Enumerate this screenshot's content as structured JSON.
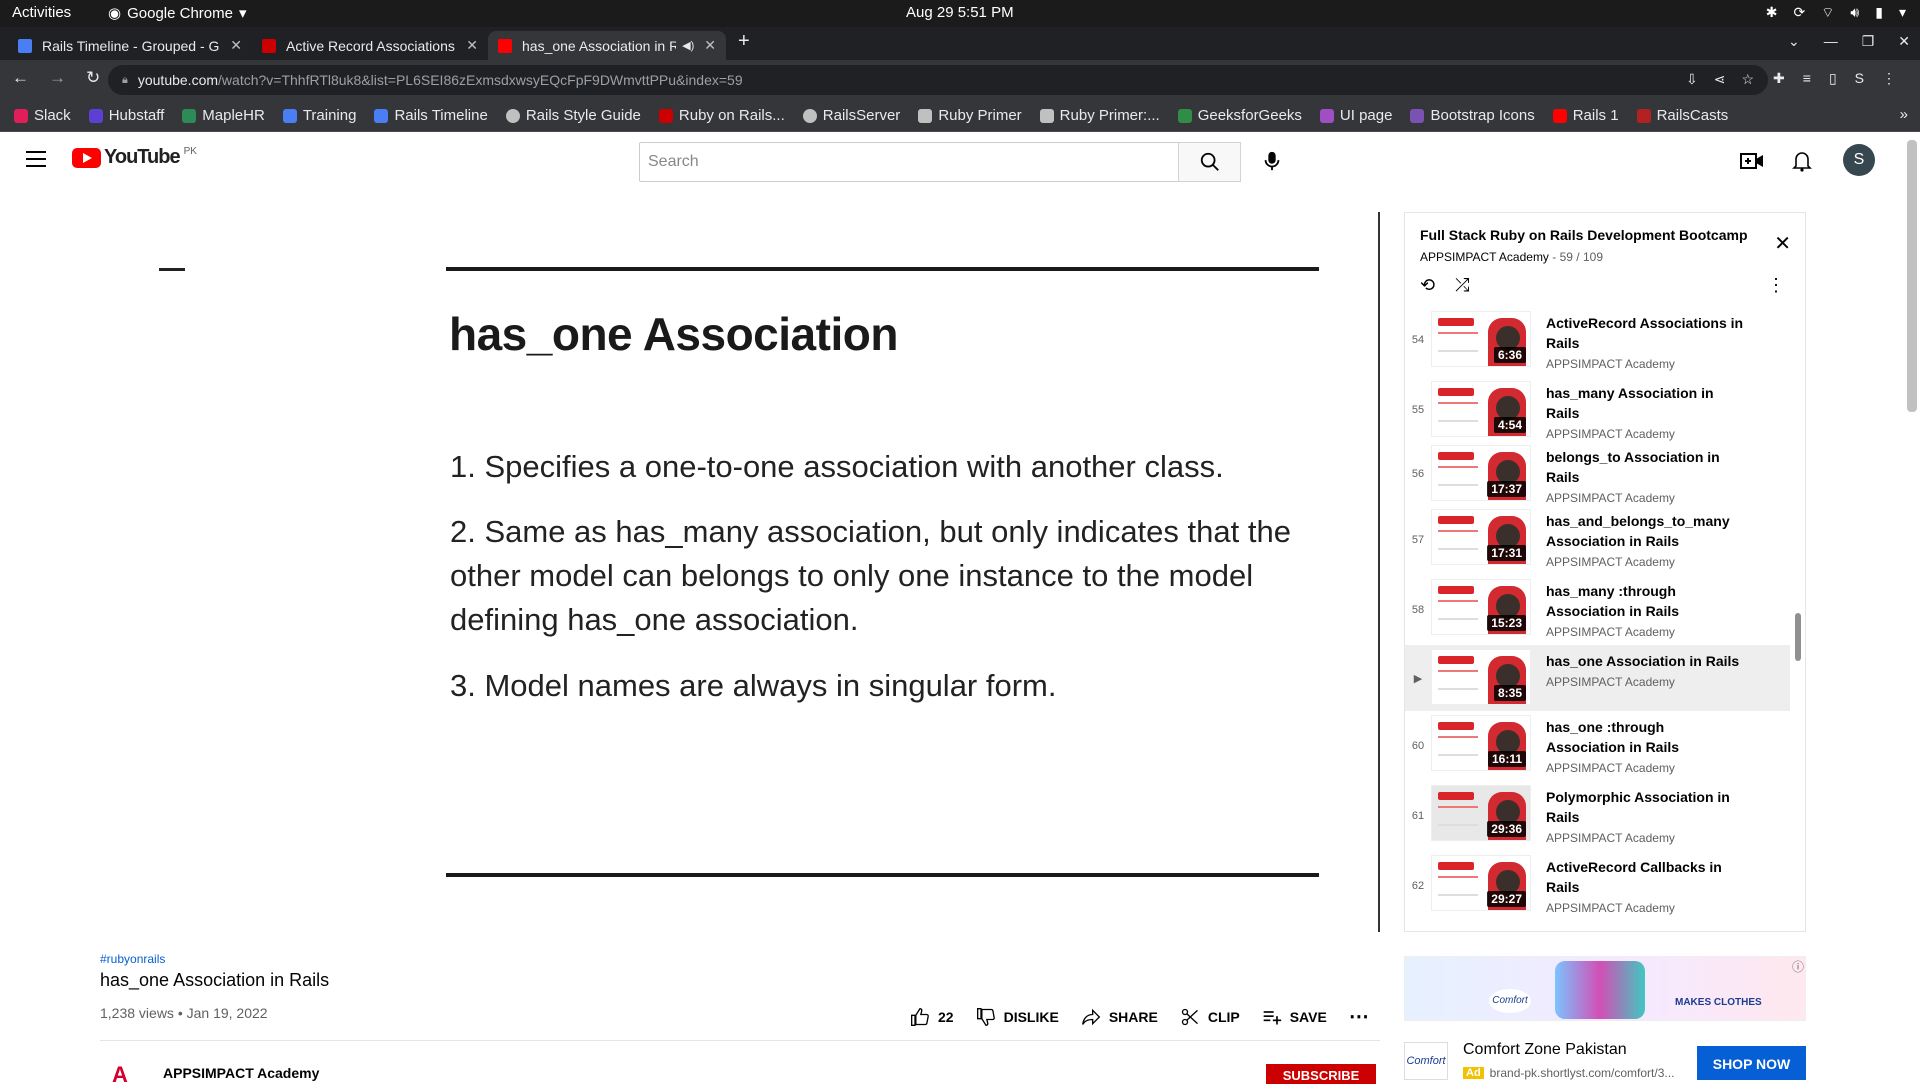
{
  "system": {
    "activities": "Activities",
    "app": "Google Chrome",
    "clock": "Aug 29  5:51 PM"
  },
  "tabs": [
    {
      "title": "Rails Timeline - Grouped - Google Docs",
      "active": false,
      "fav_color": "#4a7ef5"
    },
    {
      "title": "Active Record Associations — Ruby on Rails Guides",
      "active": false,
      "fav_color": "#cc0000"
    },
    {
      "title": "has_one Association in Rails - YouTube",
      "active": true,
      "fav_color": "#ff0000"
    }
  ],
  "address": {
    "host": "youtube.com",
    "path": "/watch?v=ThhfRTl8uk8&list=PL6SEI86zExmsdxwsyEQcFpF9DWmvttPPu&index=59"
  },
  "bookmarks": [
    {
      "label": "Slack",
      "color": "#e01e5a"
    },
    {
      "label": "Hubstaff",
      "color": "#5d3fd3"
    },
    {
      "label": "MapleHR",
      "color": "#2e8b57"
    },
    {
      "label": "Training",
      "color": "#4a7ef5"
    },
    {
      "label": "Rails Timeline",
      "color": "#4a7ef5"
    },
    {
      "label": "Rails Style Guide",
      "color": "#c0c0c0"
    },
    {
      "label": "Ruby on Rails...",
      "color": "#cc0000"
    },
    {
      "label": "RailsServer",
      "color": "#c0c0c0"
    },
    {
      "label": "Ruby Primer",
      "color": "#c0c0c0"
    },
    {
      "label": "Ruby Primer:...",
      "color": "#c0c0c0"
    },
    {
      "label": "GeeksforGeeks",
      "color": "#2f8d46"
    },
    {
      "label": "UI page",
      "color": "#a04ec4"
    },
    {
      "label": "Bootstrap Icons",
      "color": "#7952b3"
    },
    {
      "label": "Rails 1",
      "color": "#ff0000"
    },
    {
      "label": "RailsCasts",
      "color": "#b22222"
    }
  ],
  "yt": {
    "logo": "YouTube",
    "country": "PK",
    "search_placeholder": "Search",
    "avatar": "S"
  },
  "slide": {
    "title": "has_one Association",
    "points": [
      "1. Specifies a one-to-one association with another class.",
      "2. Same as has_many association, but only indicates that the other model can belongs to only one instance to the model defining has_one association.",
      "3. Model names are always in singular form."
    ]
  },
  "video": {
    "hashtag": "#rubyonrails",
    "title": "has_one Association in Rails",
    "views": "1,238 views • Jan 19, 2022",
    "likes": "22",
    "dislike": "DISLIKE",
    "share": "SHARE",
    "clip": "CLIP",
    "save": "SAVE",
    "channel": "APPSIMPACT Academy",
    "subscribe": "SUBSCRIBE"
  },
  "playlist": {
    "title": "Full Stack Ruby on Rails Development Bootcamp",
    "owner": "APPSIMPACT Academy",
    "position": "59 / 109",
    "items": [
      {
        "idx": "54",
        "title": "ActiveRecord Associations in Rails",
        "channel": "APPSIMPACT Academy",
        "dur": "6:36"
      },
      {
        "idx": "55",
        "title": "has_many Association in Rails",
        "channel": "APPSIMPACT Academy",
        "dur": "4:54"
      },
      {
        "idx": "56",
        "title": "belongs_to Association in Rails",
        "channel": "APPSIMPACT Academy",
        "dur": "17:37"
      },
      {
        "idx": "57",
        "title": "has_and_belongs_to_many Association in Rails",
        "channel": "APPSIMPACT Academy",
        "dur": "17:31"
      },
      {
        "idx": "58",
        "title": "has_many :through Association in Rails",
        "channel": "APPSIMPACT Academy",
        "dur": "15:23"
      },
      {
        "idx": "▶",
        "title": "has_one Association in Rails",
        "channel": "APPSIMPACT Academy",
        "dur": "8:35"
      },
      {
        "idx": "60",
        "title": "has_one :through Association in Rails",
        "channel": "APPSIMPACT Academy",
        "dur": "16:11"
      },
      {
        "idx": "61",
        "title": "Polymorphic Association in Rails",
        "channel": "APPSIMPACT Academy",
        "dur": "29:36"
      },
      {
        "idx": "62",
        "title": "ActiveRecord Callbacks in Rails",
        "channel": "APPSIMPACT Academy",
        "dur": "29:27"
      }
    ]
  },
  "ad": {
    "brand": "Comfort",
    "banner_tag": "MAKES CLOTHES",
    "title": "Comfort Zone Pakistan",
    "ad_label": "Ad",
    "url": "brand-pk.shortlyst.com/comfort/3...",
    "cta": "SHOP NOW"
  }
}
